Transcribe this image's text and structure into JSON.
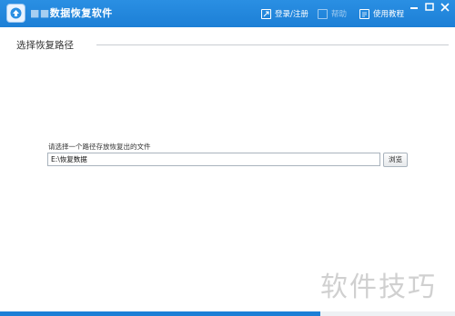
{
  "window": {
    "title": "数据恢复软件",
    "title_prefix": "■■"
  },
  "toolbar": {
    "login_label": "登录/注册",
    "second_label": "帮助",
    "tutorial_label": "使用教程"
  },
  "section": {
    "title": "选择恢复路径"
  },
  "path_field": {
    "caption": "请选择一个路径存放恢复出的文件",
    "value": "E:\\恢复数据",
    "browse_label": "浏览"
  },
  "watermark": {
    "text": "软件技巧"
  },
  "colors": {
    "titlebar": "#1c7fd6",
    "bottom_bar": "#1c7fd6"
  }
}
